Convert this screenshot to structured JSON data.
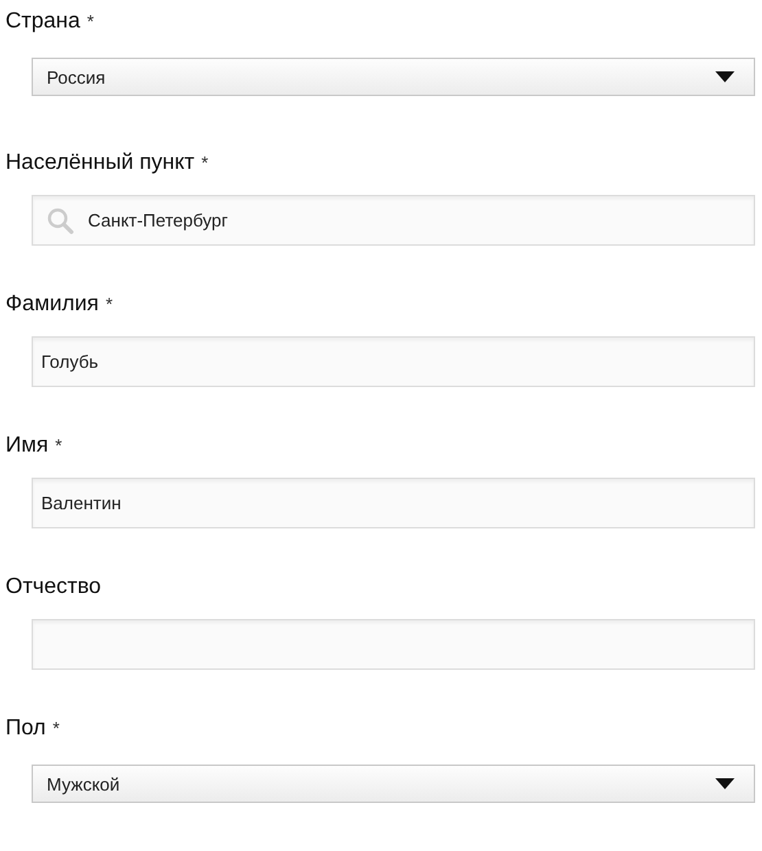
{
  "fields": [
    {
      "kind": "select",
      "label": "Страна",
      "required_mark": "*",
      "value": "Россия"
    },
    {
      "kind": "search",
      "label": "Населённый пункт",
      "required_mark": "*",
      "value": "Санкт-Петербург"
    },
    {
      "kind": "text",
      "label": "Фамилия",
      "required_mark": "*",
      "value": "Голубь"
    },
    {
      "kind": "text",
      "label": "Имя",
      "required_mark": "*",
      "value": "Валентин"
    },
    {
      "kind": "text",
      "label": "Отчество"
    },
    {
      "kind": "select",
      "label": "Пол",
      "required_mark": "*",
      "value": "Мужской"
    }
  ]
}
